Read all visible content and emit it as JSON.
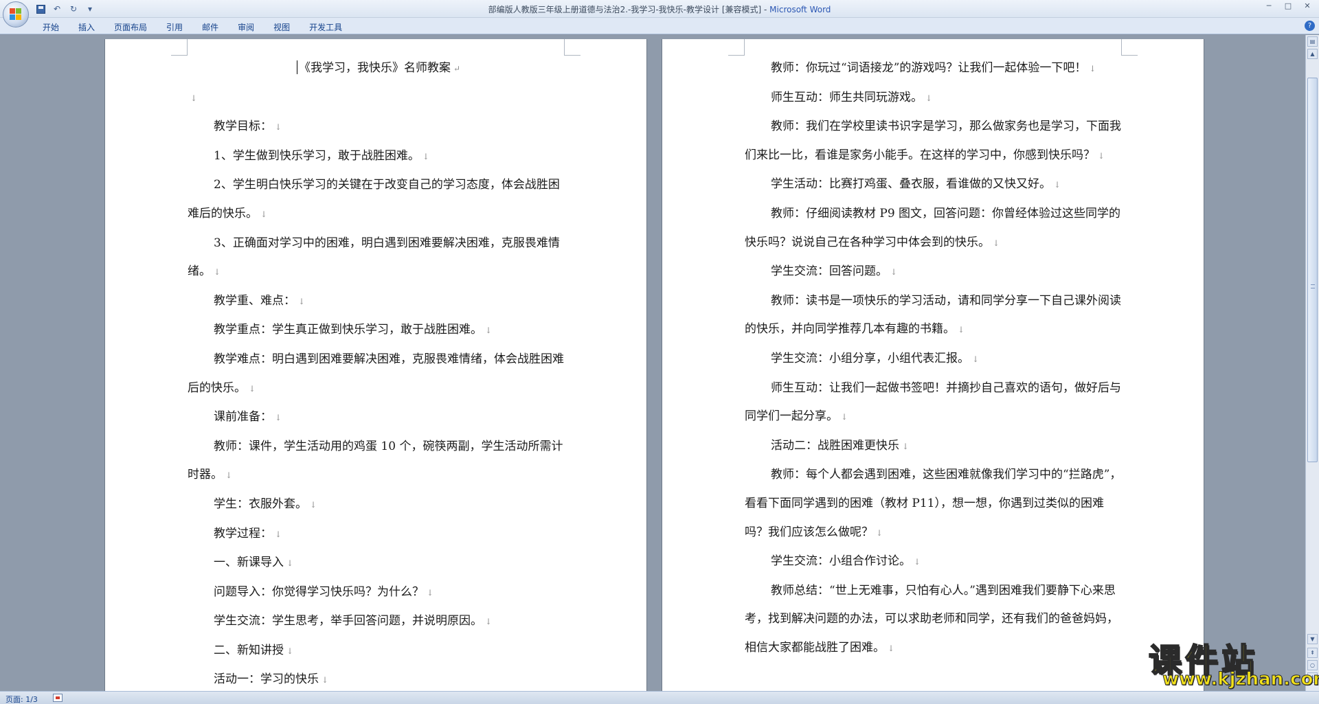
{
  "window": {
    "title_doc": "部编版人教版三年级上册道德与法治2.-我学习-我快乐-教学设计 [兼容模式] - ",
    "title_app": "Microsoft Word"
  },
  "ribbon": {
    "tabs": [
      "开始",
      "插入",
      "页面布局",
      "引用",
      "邮件",
      "审阅",
      "视图",
      "开发工具"
    ]
  },
  "left_page": {
    "title": "《我学习，我快乐》名师教案",
    "paragraphs": [
      {
        "text": "",
        "indent": false
      },
      {
        "text": "教学目标：",
        "indent": true
      },
      {
        "text": "1、学生做到快乐学习，敢于战胜困难。",
        "indent": true
      },
      {
        "text": "2、学生明白快乐学习的关键在于改变自己的学习态度，体会战胜困难后的快乐。",
        "indent": true
      },
      {
        "text": "3、正确面对学习中的困难，明白遇到困难要解决困难，克服畏难情绪。",
        "indent": true
      },
      {
        "text": "教学重、难点：",
        "indent": true
      },
      {
        "text": "教学重点：学生真正做到快乐学习，敢于战胜困难。",
        "indent": true
      },
      {
        "text": "教学难点：明白遇到困难要解决困难，克服畏难情绪，体会战胜困难后的快乐。",
        "indent": true
      },
      {
        "text": "课前准备：",
        "indent": true
      },
      {
        "text": "教师：课件，学生活动用的鸡蛋 10 个，碗筷两副，学生活动所需计时器。",
        "indent": true
      },
      {
        "text": "学生：衣服外套。",
        "indent": true
      },
      {
        "text": "教学过程：",
        "indent": true
      },
      {
        "text": "一、新课导入",
        "indent": true
      },
      {
        "text": "问题导入：你觉得学习快乐吗？为什么？",
        "indent": true
      },
      {
        "text": "学生交流：学生思考，举手回答问题，并说明原因。",
        "indent": true
      },
      {
        "text": "二、新知讲授",
        "indent": true
      },
      {
        "text": "活动一：学习的快乐",
        "indent": true
      }
    ]
  },
  "right_page": {
    "paragraphs": [
      {
        "text": "教师：你玩过“词语接龙”的游戏吗？让我们一起体验一下吧！",
        "indent": true
      },
      {
        "text": "师生互动：师生共同玩游戏。",
        "indent": true
      },
      {
        "text": "教师：我们在学校里读书识字是学习，那么做家务也是学习，下面我们来比一比，看谁是家务小能手。在这样的学习中，你感到快乐吗？",
        "indent": true
      },
      {
        "text": "学生活动：比赛打鸡蛋、叠衣服，看谁做的又快又好。",
        "indent": true
      },
      {
        "text": "教师：仔细阅读教材 P9 图文，回答问题：你曾经体验过这些同学的快乐吗？说说自己在各种学习中体会到的快乐。",
        "indent": true
      },
      {
        "text": "学生交流：回答问题。",
        "indent": true
      },
      {
        "text": "教师：读书是一项快乐的学习活动，请和同学分享一下自己课外阅读的快乐，并向同学推荐几本有趣的书籍。",
        "indent": true
      },
      {
        "text": "学生交流：小组分享，小组代表汇报。",
        "indent": true
      },
      {
        "text": "师生互动：让我们一起做书签吧！并摘抄自己喜欢的语句，做好后与同学们一起分享。",
        "indent": true
      },
      {
        "text": "活动二：战胜困难更快乐",
        "indent": true
      },
      {
        "text": "教师：每个人都会遇到困难，这些困难就像我们学习中的“拦路虎”，看看下面同学遇到的困难（教材 P11），想一想，你遇到过类似的困难吗？我们应该怎么做呢？",
        "indent": true
      },
      {
        "text": "学生交流：小组合作讨论。",
        "indent": true
      },
      {
        "text": "教师总结：“世上无难事，只怕有心人。”遇到困难我们要静下心来思考，找到解决问题的办法，可以求助老师和同学，还有我们的爸爸妈妈，相信大家都能战胜了困难。",
        "indent": true
      }
    ]
  },
  "paragraph_mark": "↓",
  "statusbar": {
    "page_info": "页面: 1/3"
  },
  "watermark": {
    "main": "课件站",
    "url": "www.kjzhan.com"
  }
}
